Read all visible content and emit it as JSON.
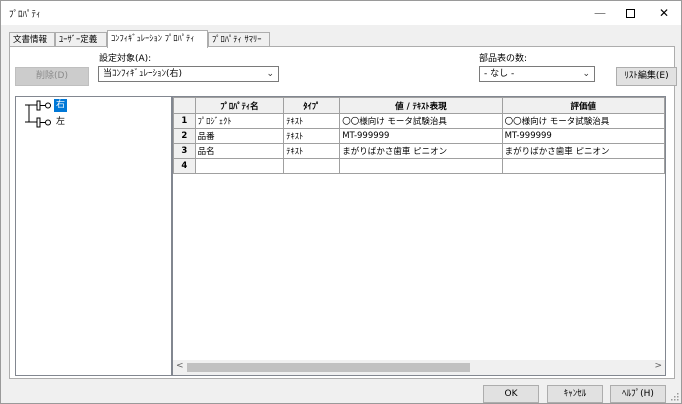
{
  "window": {
    "title": "ﾌﾟﾛﾊﾟﾃｨ"
  },
  "tabs": [
    {
      "label": "文書情報"
    },
    {
      "label": "ﾕｰｻﾞｰ定義"
    },
    {
      "label": "ｺﾝﾌｨｷﾞｭﾚｰｼｮﾝ ﾌﾟﾛﾊﾟﾃｨ",
      "active": true
    },
    {
      "label": "ﾌﾟﾛﾊﾟﾃｨ ｻﾏﾘｰ"
    }
  ],
  "panel": {
    "target_label": "設定対象(A):",
    "target_value": "当ｺﾝﾌｨｷﾞｭﾚｰｼｮﾝ(右)",
    "delete_button": "削除(D)",
    "parts_table_label": "部品表の数:",
    "parts_table_value": "- なし -",
    "list_edit_button": "ﾘｽﾄ編集(E)"
  },
  "tree": {
    "items": [
      {
        "label": "右",
        "selected": true
      },
      {
        "label": "左",
        "selected": false
      }
    ]
  },
  "grid": {
    "headers": [
      "ﾌﾟﾛﾊﾟﾃｨ名",
      "ﾀｲﾌﾟ",
      "値 / ﾃｷｽﾄ表現",
      "評価値"
    ],
    "rows": [
      {
        "num": "1",
        "cells": [
          "ﾌﾟﾛｼﾞｪｸﾄ",
          "ﾃｷｽﾄ",
          "〇〇様向け モータ試験治具",
          "〇〇様向け モータ試験治具"
        ]
      },
      {
        "num": "2",
        "cells": [
          "品番",
          "ﾃｷｽﾄ",
          "MT-999999",
          "MT-999999"
        ]
      },
      {
        "num": "3",
        "cells": [
          "品名",
          "ﾃｷｽﾄ",
          "まがりばかさ歯車 ピニオン",
          "まがりばかさ歯車 ピニオン"
        ]
      },
      {
        "num": "4",
        "cells": [
          "",
          "",
          "",
          ""
        ]
      }
    ]
  },
  "footer": {
    "ok": "OK",
    "cancel": "ｷｬﾝｾﾙ",
    "help": "ﾍﾙﾌﾟ(H)"
  }
}
